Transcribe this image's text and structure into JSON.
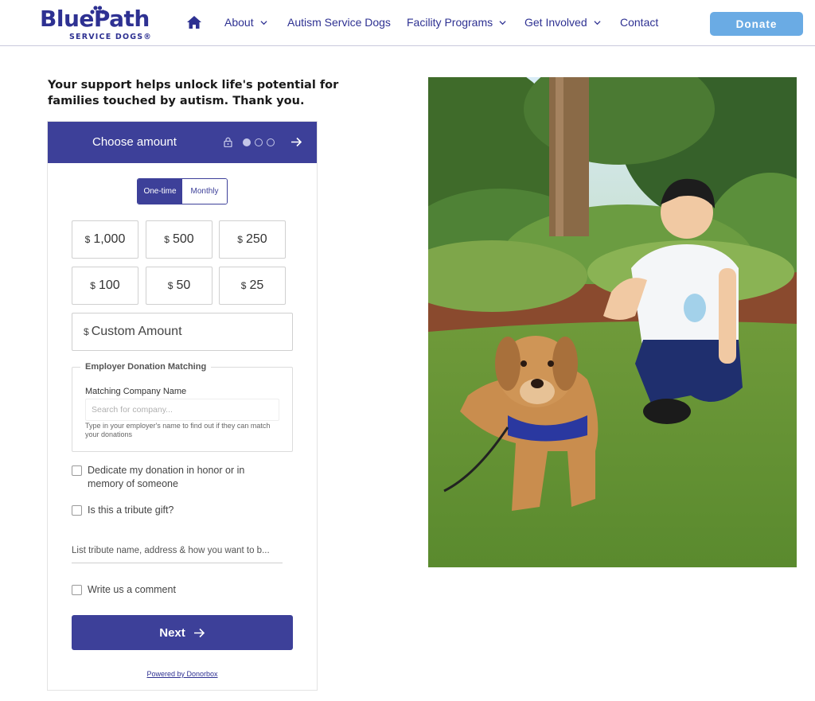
{
  "brand": {
    "name": "BluePath",
    "tagline": "SERVICE DOGS®"
  },
  "nav": {
    "items": [
      {
        "label": "About"
      },
      {
        "label": "Autism Service Dogs"
      },
      {
        "label": "Facility Programs"
      },
      {
        "label": "Get Involved"
      },
      {
        "label": "Contact"
      }
    ],
    "donate_label": "Donate"
  },
  "intro_text": "Your support helps unlock life's potential for families touched by autism. Thank you.",
  "widget": {
    "header_title": "Choose amount",
    "frequency": {
      "one_time": "One-time",
      "monthly": "Monthly",
      "selected": "One-time"
    },
    "currency_symbol": "$",
    "amounts": [
      "1,000",
      "500",
      "250",
      "100",
      "50",
      "25"
    ],
    "custom_placeholder": "Custom Amount",
    "matching": {
      "legend": "Employer Donation Matching",
      "label": "Matching Company Name",
      "placeholder": "Search for company...",
      "help": "Type in your employer's name to find out if they can match your donations"
    },
    "dedicate_label": "Dedicate my donation in honor or in memory of someone",
    "tribute_label": "Is this a tribute gift?",
    "tribute_placeholder": "List tribute name, address & how you want to b...",
    "comment_label": "Write us a comment",
    "next_label": "Next",
    "powered_by": "Powered by Donorbox"
  },
  "colors": {
    "brand_navy": "#2e3192",
    "widget_purple": "#3d4099",
    "donate_blue": "#6aabe4"
  },
  "icons": {
    "home": "home-icon",
    "lock": "lock-icon",
    "next_arrow": "arrow-right-icon",
    "chevron": "chevron-down-icon"
  }
}
